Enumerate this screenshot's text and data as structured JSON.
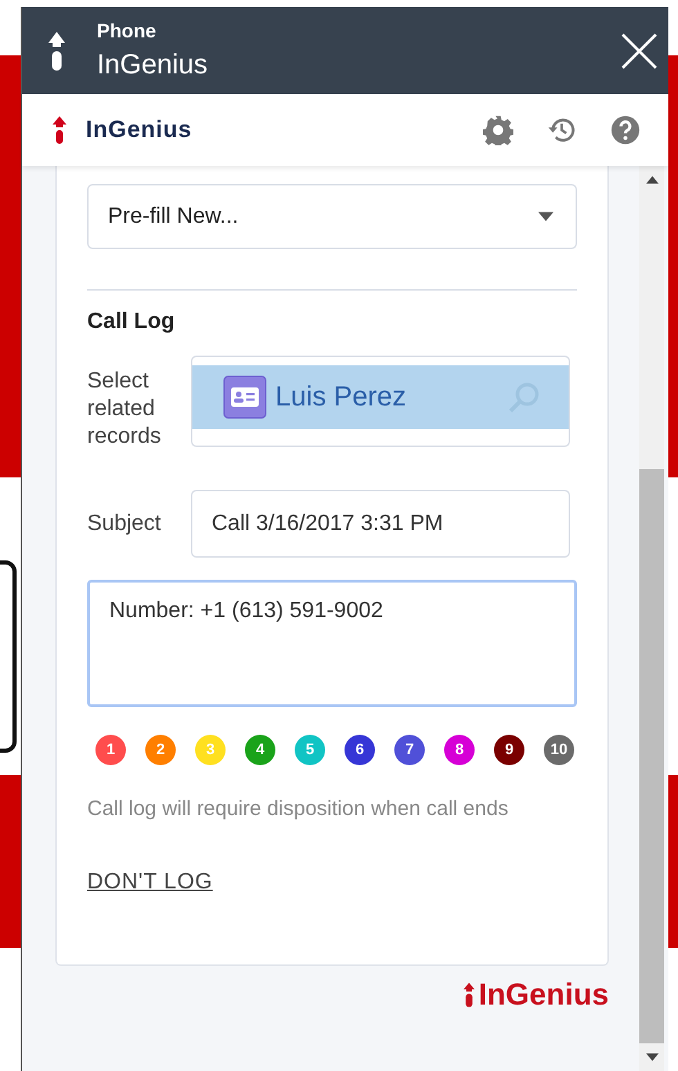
{
  "window": {
    "subtitle": "Phone",
    "title": "InGenius"
  },
  "header": {
    "brand": "InGenius"
  },
  "prefill": {
    "value": "Pre-fill New..."
  },
  "call_log": {
    "heading": "Call Log",
    "related": {
      "label": "Select related records",
      "value": "Luis Perez"
    },
    "subject": {
      "label": "Subject",
      "value": "Call 3/16/2017 3:31 PM"
    },
    "notes": {
      "value": "Number: +1 (613) 591-9002"
    },
    "dispositions": [
      {
        "label": "1",
        "color": "#ff4d4d"
      },
      {
        "label": "2",
        "color": "#ff7f00"
      },
      {
        "label": "3",
        "color": "#ffe020"
      },
      {
        "label": "4",
        "color": "#1aa31a"
      },
      {
        "label": "5",
        "color": "#11c4c4"
      },
      {
        "label": "6",
        "color": "#3636d6"
      },
      {
        "label": "7",
        "color": "#5050d8"
      },
      {
        "label": "8",
        "color": "#d600d6"
      },
      {
        "label": "9",
        "color": "#7a0000"
      },
      {
        "label": "10",
        "color": "#6b6b6b"
      }
    ],
    "note": "Call log will require disposition when call ends",
    "dont_log": "DON'T LOG"
  },
  "footer": {
    "brand": "InGenius"
  }
}
